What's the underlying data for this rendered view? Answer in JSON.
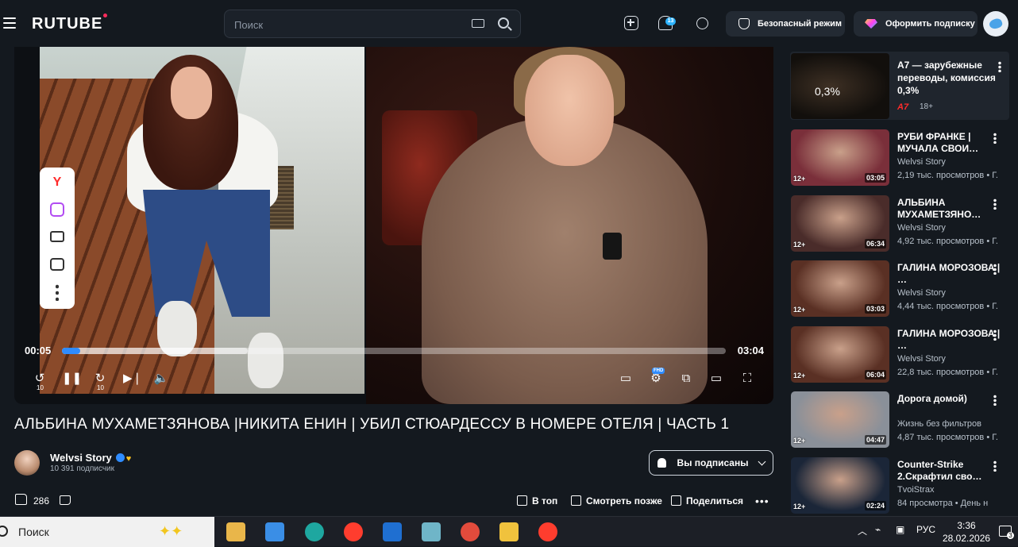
{
  "header": {
    "logo": "RUTUBE",
    "search_placeholder": "Поиск",
    "notification_count": "13",
    "safe_mode_label": "Безопасный режим",
    "subscribe_plan_label": "Оформить подписку"
  },
  "player": {
    "current_time": "00:05",
    "duration": "03:04",
    "progress_fraction": 0.028,
    "buffered_fraction": 0.28,
    "rewind_label": "10",
    "forward_label": "10",
    "quality_badge": "FHD"
  },
  "video": {
    "title": "АЛЬБИНА МУХАМЕТЗЯНОВА |НИКИТА ЕНИН | УБИЛ СТЮАРДЕССУ В НОМЕРЕ ОТЕЛЯ | ЧАСТЬ 1",
    "channel_name": "Welvsi Story",
    "subscribers": "10 391 подписчик",
    "subscribed_label": "Вы подписаны",
    "likes": "286",
    "to_top_label": "В топ",
    "watch_later_label": "Смотреть позже",
    "share_label": "Поделиться"
  },
  "ad": {
    "title": "А7 — зарубежные переводы, комиссия 0,3%",
    "brand": "А7",
    "age": "18+",
    "thumb_text": "0,3%"
  },
  "recommendations": [
    {
      "title": "РУБИ ФРАНКЕ | МУЧАЛА СВОИ…",
      "channel": "Welvsi Story",
      "views": "2,19 тыс. просмотров • Г.",
      "age": "12+",
      "duration": "03:05",
      "thumb_color": "#7a2f3a"
    },
    {
      "title": "АЛЬБИНА МУХАМЕТЗЯНО…",
      "channel": "Welvsi Story",
      "views": "4,92 тыс. просмотров • Г.",
      "age": "12+",
      "duration": "06:34",
      "thumb_color": "#4a2c2a"
    },
    {
      "title": "ГАЛИНА МОРОЗОВА | …",
      "channel": "Welvsi Story",
      "views": "4,44 тыс. просмотров • Г.",
      "age": "12+",
      "duration": "03:03",
      "thumb_color": "#5a3024"
    },
    {
      "title": "ГАЛИНА МОРОЗОВА | …",
      "channel": "Welvsi Story",
      "views": "22,8 тыс. просмотров • Г.",
      "age": "12+",
      "duration": "06:04",
      "thumb_color": "#5a3024"
    },
    {
      "title": "Дорога домой)",
      "channel": "Жизнь без фильтров",
      "views": "4,87 тыс. просмотров • Г.",
      "age": "12+",
      "duration": "04:47",
      "thumb_color": "#8a9099"
    },
    {
      "title": "Counter-Strike 2.Скрафтил сво…",
      "channel": "TvoiStrax",
      "views": "84 просмотра • День н",
      "age": "12+",
      "duration": "02:24",
      "thumb_color": "#1b2638"
    }
  ],
  "taskbar": {
    "search_label": "Поиск",
    "language": "РУС",
    "time": "3:36",
    "date": "28.02.2026",
    "notification_count": "3"
  },
  "colors": {
    "accent": "#2f8cff",
    "background": "#14191f",
    "brand_red": "#ff2b5b"
  }
}
